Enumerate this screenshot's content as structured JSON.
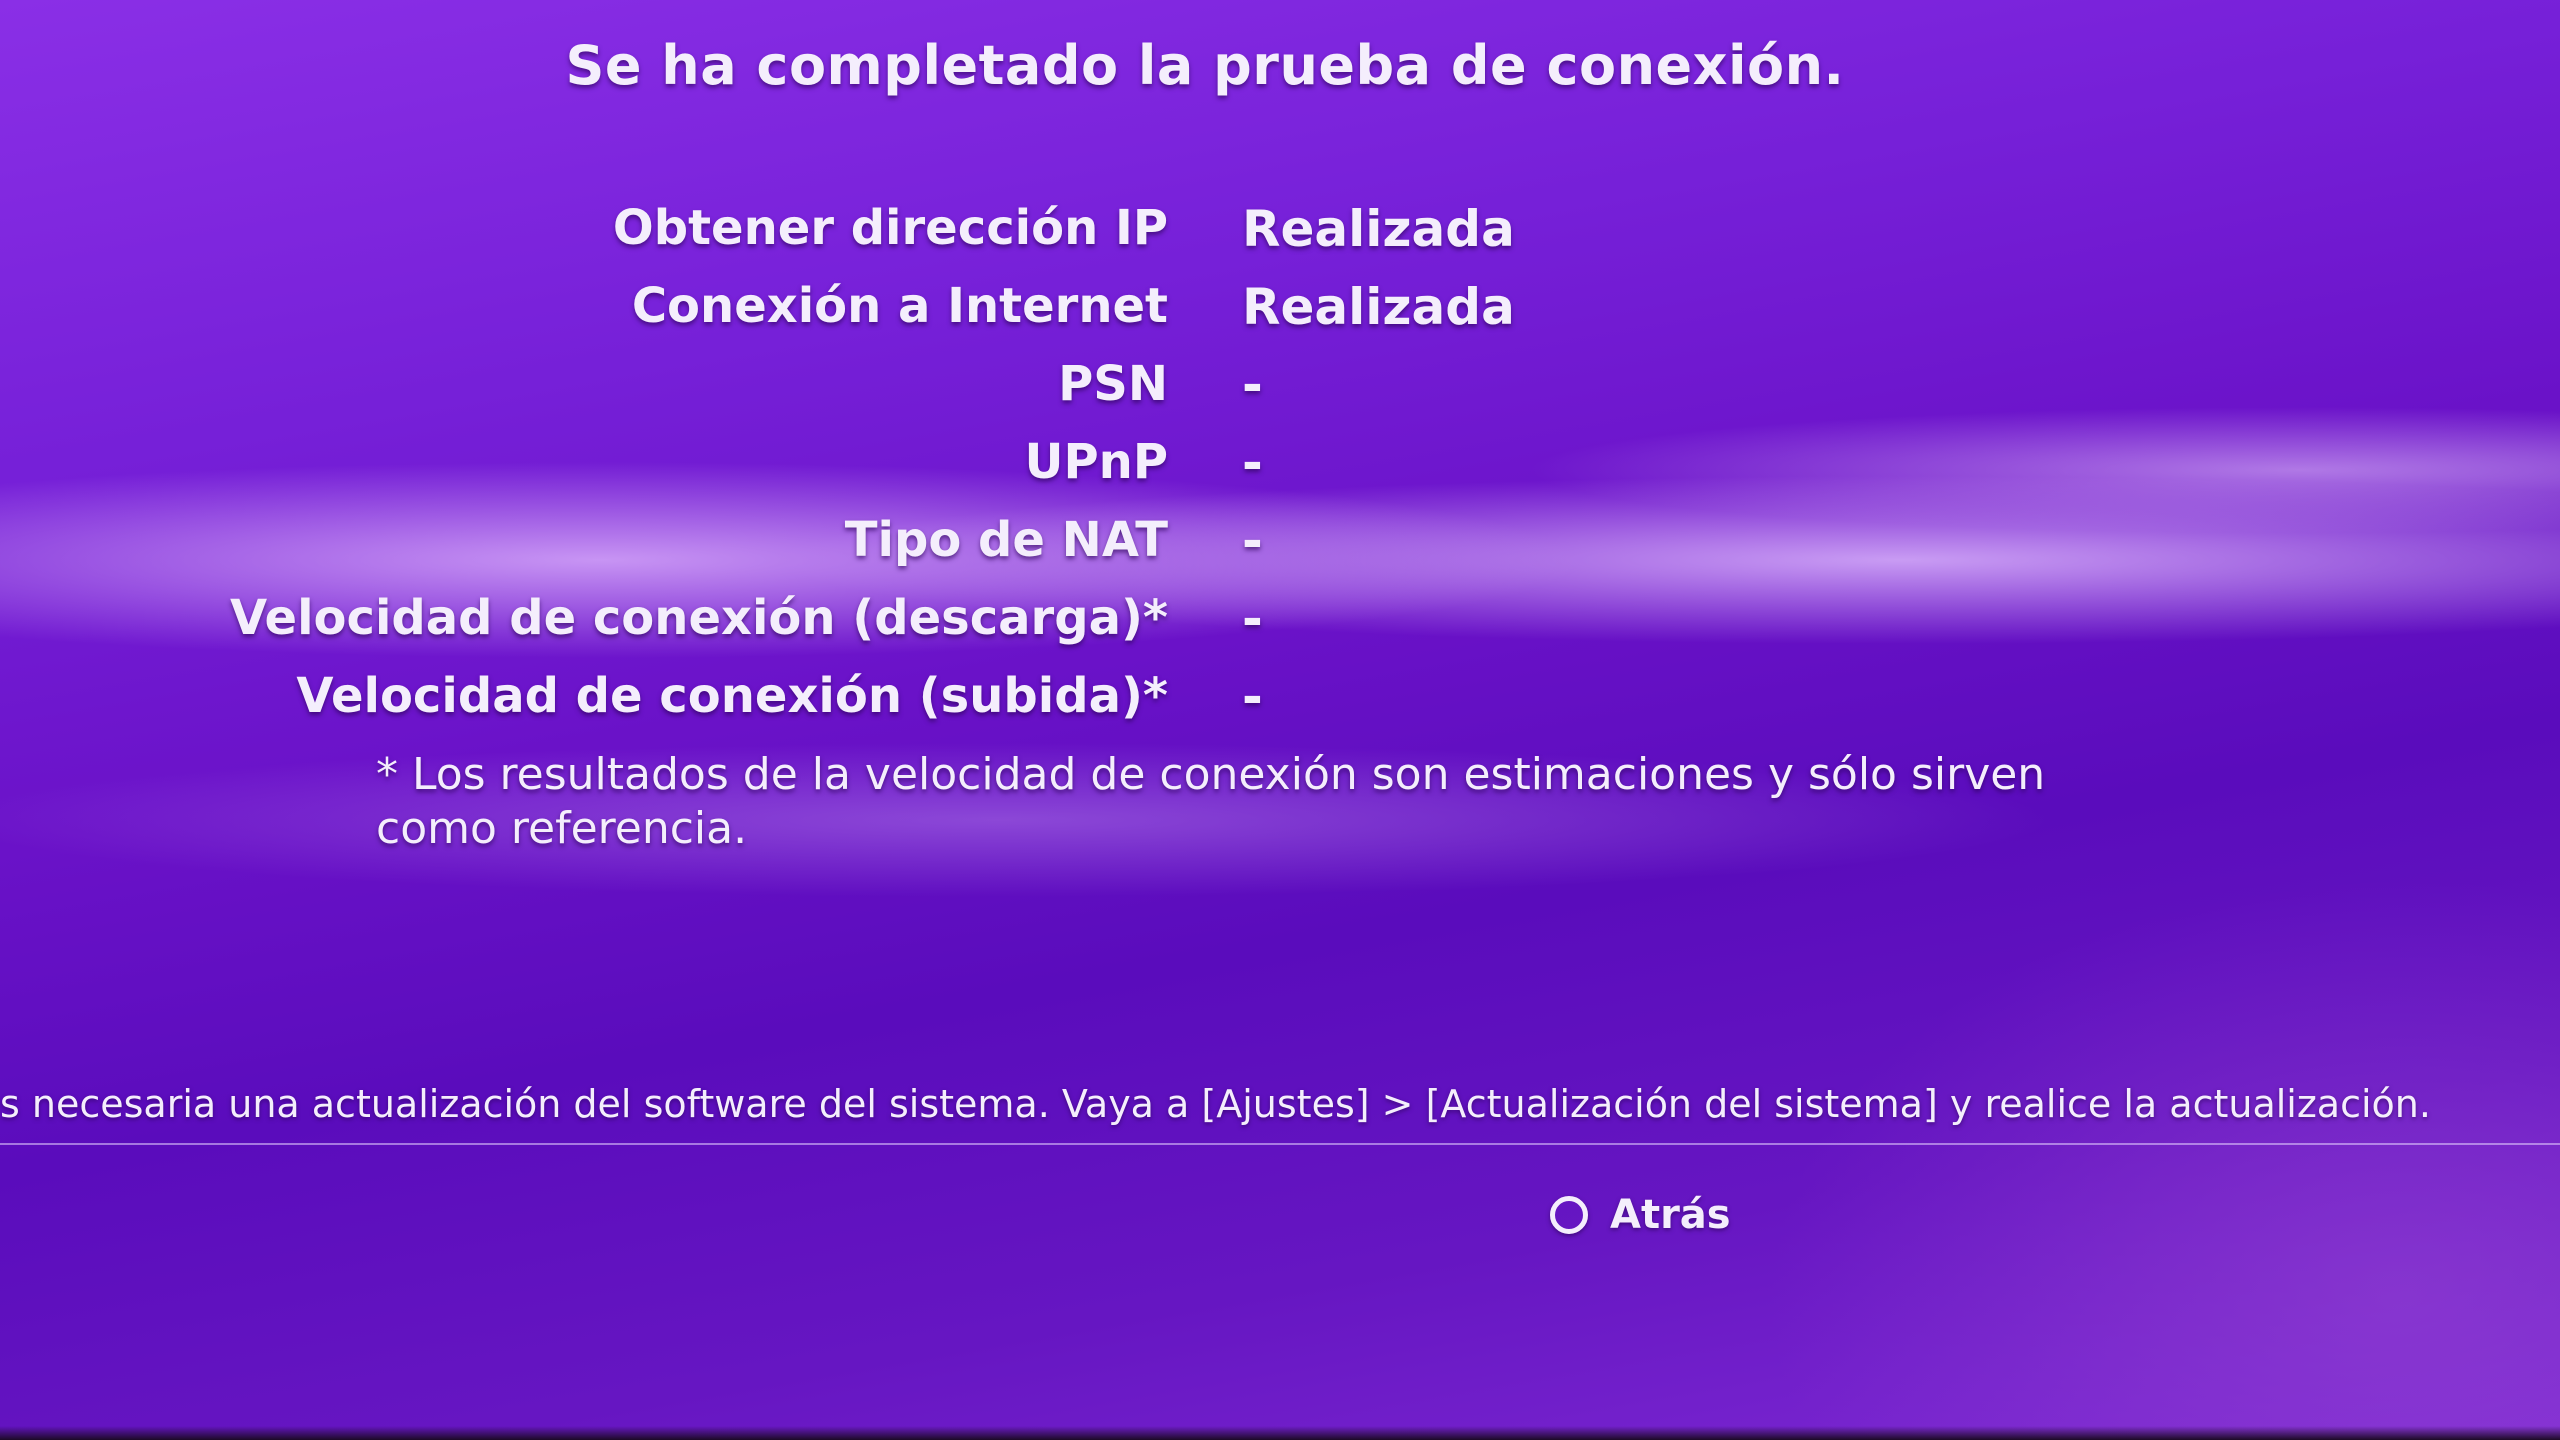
{
  "header": {
    "title": "Se ha completado la prueba de conexión."
  },
  "results": [
    {
      "label": "Obtener dirección IP",
      "value": "Realizada"
    },
    {
      "label": "Conexión a Internet",
      "value": "Realizada"
    },
    {
      "label": "PSN",
      "value": "-"
    },
    {
      "label": "UPnP",
      "value": "-"
    },
    {
      "label": "Tipo de NAT",
      "value": "-"
    },
    {
      "label": "Velocidad de conexión (descarga)*",
      "value": "-"
    },
    {
      "label": "Velocidad de conexión (subida)*",
      "value": "-"
    }
  ],
  "footnote": "* Los resultados de la velocidad de conexión son estimaciones y sólo sirven como referencia.",
  "notice": "s necesaria una actualización del software del sistema. Vaya a [Ajustes] > [Actualización del sistema] y realice la actualización.",
  "controls": {
    "back_icon": "circle-button-icon",
    "back_label": "Atrás"
  }
}
